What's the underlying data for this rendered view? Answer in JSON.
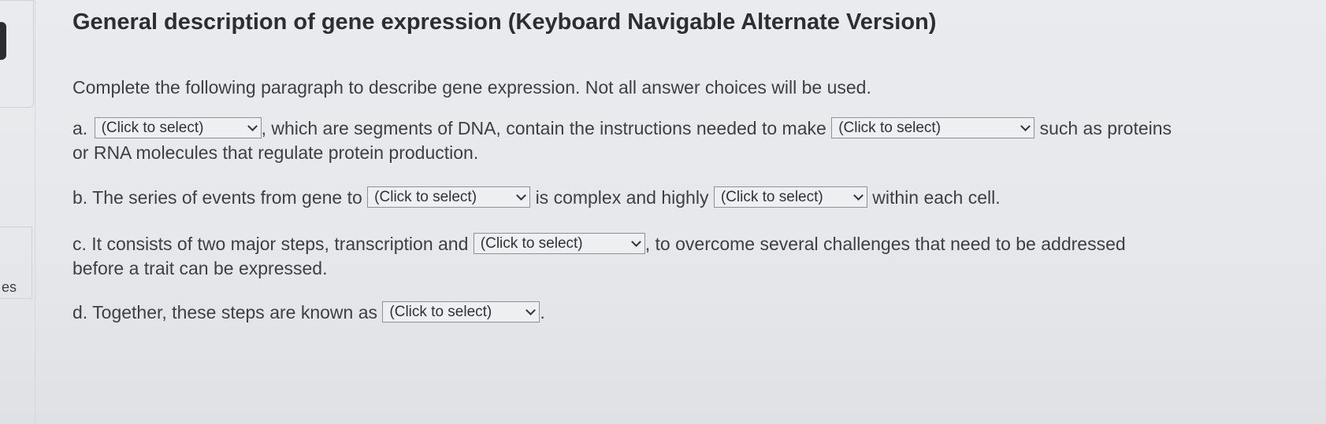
{
  "title": "General description of gene expression (Keyboard Navigable Alternate Version)",
  "instructions": "Complete the following paragraph to describe gene expression. Not all answer choices will be used.",
  "left_strip_text": "es",
  "select_placeholder": "(Click to select)",
  "items": {
    "a": {
      "prefix": "a.",
      "text1": ", which are segments of DNA, contain the instructions needed to make",
      "text2": "such as proteins",
      "text3": "or RNA molecules that regulate protein production."
    },
    "b": {
      "prefix": "b. The series of events from gene to",
      "text1": "is complex and highly",
      "text2": "within each cell."
    },
    "c": {
      "prefix": "c. It consists of two major steps, transcription and",
      "text1": ", to overcome several challenges that need to be addressed",
      "text2": "before a trait can be expressed."
    },
    "d": {
      "prefix": "d. Together, these steps are known as",
      "text1": "."
    }
  }
}
